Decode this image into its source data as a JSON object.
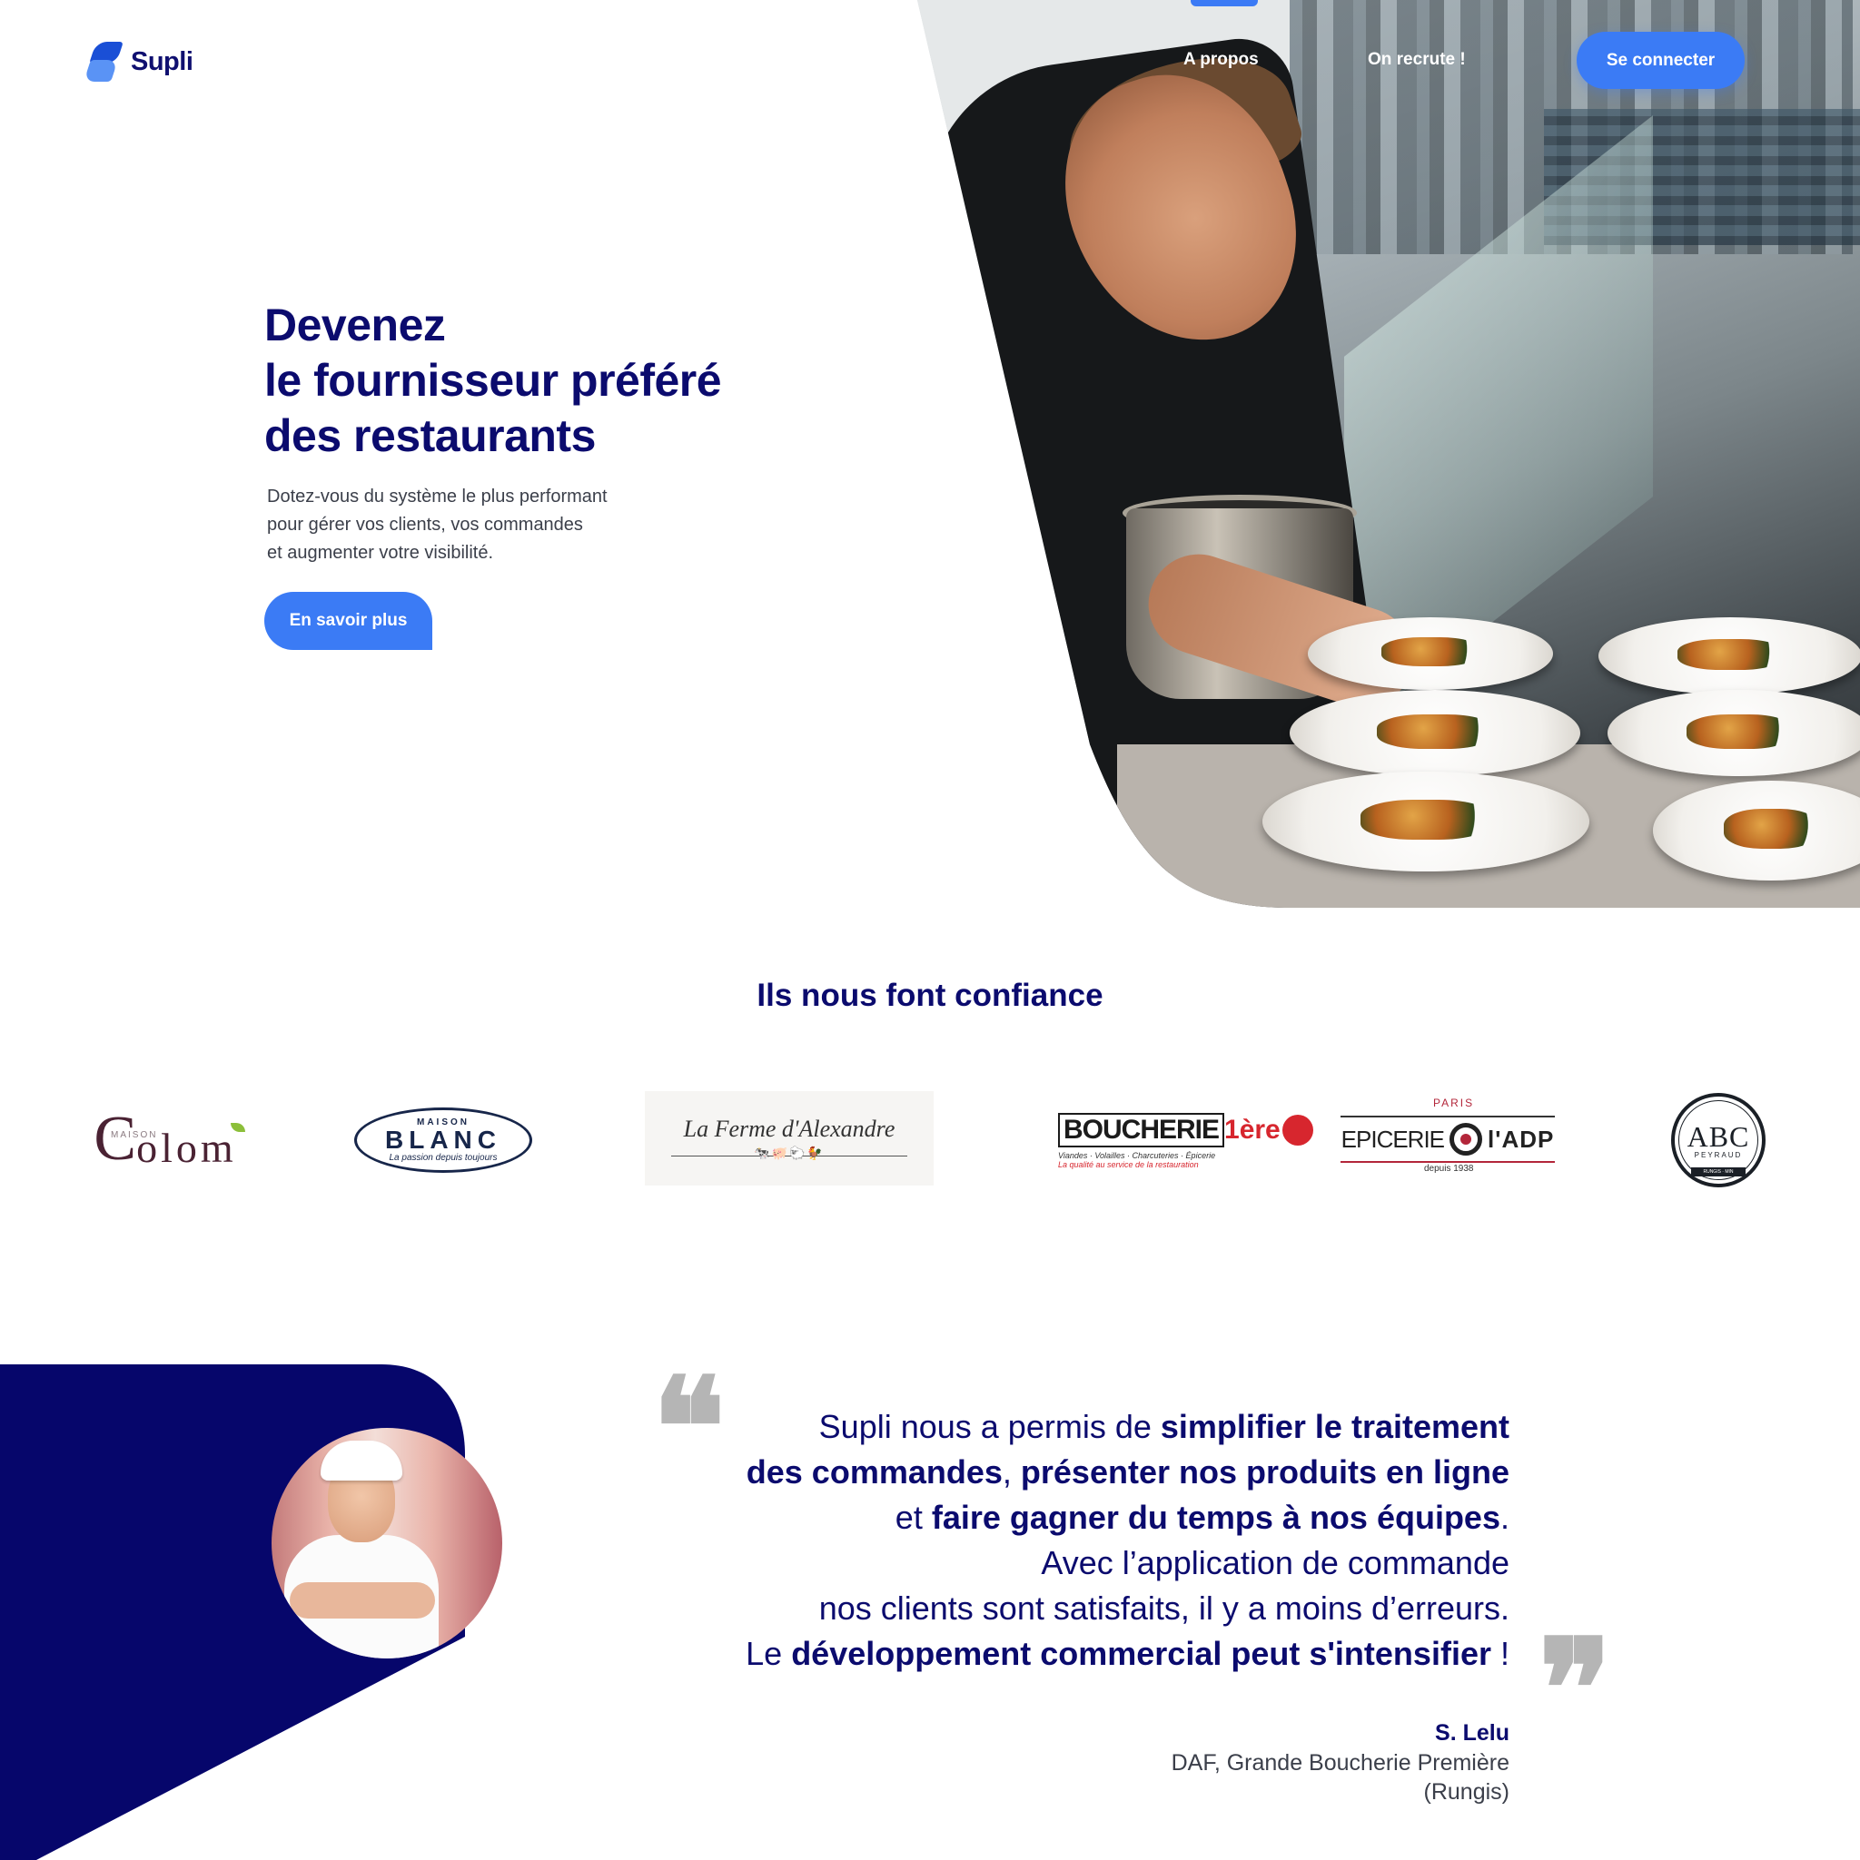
{
  "brand": {
    "name": "Supli",
    "primary_color": "#3b7bf5",
    "navy_color": "#0b0b6e"
  },
  "nav": {
    "items": [
      {
        "label": "A propos"
      },
      {
        "label": "On recrute !"
      }
    ],
    "login_label": "Se connecter"
  },
  "hero": {
    "title_lines": [
      "Devenez",
      "le fournisseur préféré",
      "des restaurants"
    ],
    "subtitle_lines": [
      "Dotez-vous du système le plus performant",
      "pour gérer vos clients, vos commandes",
      "et augmenter votre visibilité."
    ],
    "cta_label": "En savoir plus"
  },
  "trust": {
    "title": "Ils nous font confiance",
    "logos": {
      "colom": {
        "maison": "MAISON",
        "first": "C",
        "rest": "olom"
      },
      "blanc": {
        "maison": "MAISON",
        "name": "BLANC",
        "tagline": "La passion depuis toujours"
      },
      "ferme": {
        "name": "La Ferme d'Alexandre"
      },
      "boucherie": {
        "word": "BOUCHERIE",
        "num": "1ère",
        "tagline1": "Viandes · Volailles · Charcuteries · Épicerie",
        "tagline2": "La qualité au service de la restauration"
      },
      "epicerie": {
        "left": "EPICERIE",
        "right": "l'ADP",
        "paris": "PARIS",
        "since": "depuis 1938"
      },
      "abc": {
        "name": "ABC",
        "sub": "PEYRAUD",
        "ribbon": "RUNGIS · MIN"
      }
    }
  },
  "testimonial": {
    "quote_open": "❝",
    "quote_close": "❞",
    "lines": [
      {
        "pre": "Supli nous a permis de ",
        "bold": "simplifier le traitement",
        "post": ""
      },
      {
        "pre": "",
        "bold": "des commandes",
        "post": ", ",
        "bold2": "présenter nos produits en ligne"
      },
      {
        "pre": "et ",
        "bold": "faire gagner du temps à nos équipes",
        "post": "."
      },
      {
        "pre": "Avec l’application de commande",
        "bold": "",
        "post": ""
      },
      {
        "pre": "nos clients sont satisfaits, il y a moins d’erreurs.",
        "bold": "",
        "post": ""
      },
      {
        "pre": "Le ",
        "bold": "développement commercial peut s'intensifier",
        "post": " !"
      }
    ],
    "author_name": "S. Lelu",
    "author_role_line1": "DAF, Grande Boucherie Première",
    "author_role_line2": "(Rungis)"
  }
}
